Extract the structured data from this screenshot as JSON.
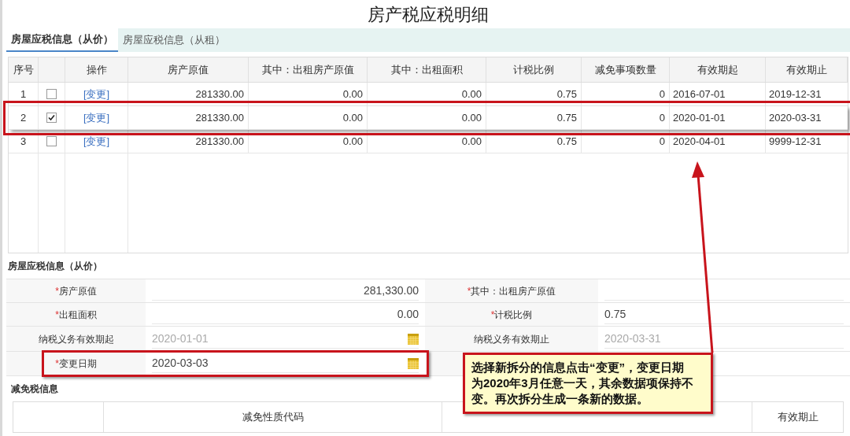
{
  "title": "房产税应税明细",
  "tabs": [
    {
      "label": "房屋应税信息（从价）",
      "selected": true
    },
    {
      "label": "房屋应税信息（从租）",
      "selected": false
    }
  ],
  "table": {
    "columns": [
      "序号",
      "",
      "操作",
      "房产原值",
      "其中：出租房产原值",
      "其中：出租面积",
      "计税比例",
      "减免事项数量",
      "有效期起",
      "有效期止"
    ],
    "rows": [
      {
        "index": "1",
        "checked": false,
        "action": "[变更]",
        "values": [
          "281330.00",
          "0.00",
          "0.00",
          "0.75",
          "0"
        ],
        "start": "2016-07-01",
        "end": "2019-12-31",
        "highlighted": false
      },
      {
        "index": "2",
        "checked": true,
        "action": "[变更]",
        "values": [
          "281330.00",
          "0.00",
          "0.00",
          "0.75",
          "0"
        ],
        "start": "2020-01-01",
        "end": "2020-03-31",
        "highlighted": true
      },
      {
        "index": "3",
        "checked": false,
        "action": "[变更]",
        "values": [
          "281330.00",
          "0.00",
          "0.00",
          "0.75",
          "0"
        ],
        "start": "2020-04-01",
        "end": "9999-12-31",
        "highlighted": false
      }
    ]
  },
  "form": {
    "title": "房屋应税信息（从价）",
    "fields": [
      {
        "mark": "*",
        "label": "房产原值",
        "kind": "number",
        "value": "281,330.00",
        "disabled": false,
        "highlighted": false
      },
      {
        "mark": "*",
        "label": "其中：出租房产原值",
        "kind": "text",
        "highlighted": false
      },
      {
        "mark": "*",
        "label": "出租面积",
        "kind": "number",
        "value": "0.00",
        "disabled": false,
        "highlighted": false
      },
      {
        "mark": "*",
        "label": "计税比例",
        "kind": "text",
        "value": "0.75",
        "disabled": false,
        "highlighted": false
      },
      {
        "label": "纳税义务有效期起",
        "kind": "date",
        "value": "2020-01-01",
        "disabled": true,
        "highlighted": false
      },
      {
        "label": "纳税义务有效期止",
        "kind": "text",
        "value": "2020-03-31",
        "disabled": true,
        "highlighted": false
      },
      {
        "mark": "*",
        "label": "变更日期",
        "kind": "date",
        "value": "2020-03-03",
        "disabled": false,
        "highlighted": true
      },
      {
        "kind": "blank"
      }
    ]
  },
  "relief": {
    "title": "减免税信息",
    "columns": [
      "减免性质代码",
      "有效期止"
    ]
  },
  "callout": "选择新拆分的信息点击“变更”，变更日期为2020年3月任意一天，其余数据项保持不变。再次拆分生成一条新的数据。"
}
